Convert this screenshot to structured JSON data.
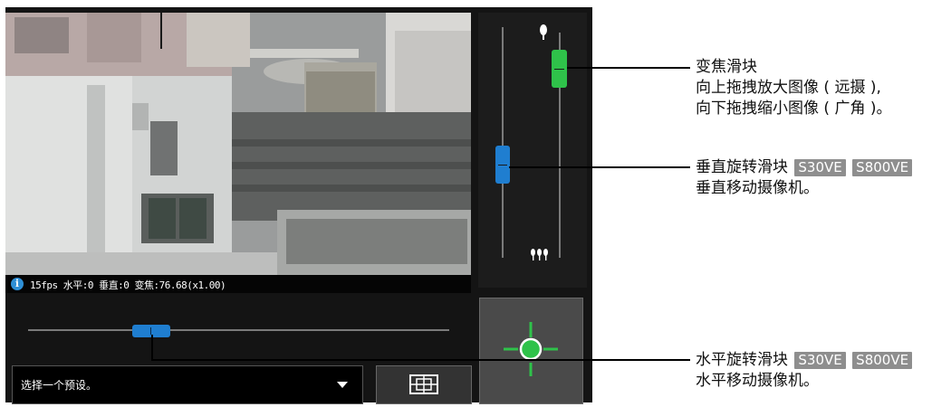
{
  "video": {
    "info_text": "15fps 水平:0 垂直:0 变焦:76.68(x1.00)"
  },
  "zoom_slider": {
    "tele_icon": "single-tree-icon",
    "wide_icon": "three-trees-icon",
    "handle_color": "#2fc24a"
  },
  "tilt_slider": {
    "handle_color": "#1f7ed0"
  },
  "pan_slider": {
    "handle_color": "#1f7ed0"
  },
  "preset": {
    "placeholder": "选择一个预设。"
  },
  "callouts": {
    "zoom": {
      "title": "变焦滑块",
      "line1": "向上拖拽放大图像 ( 远摄 ),",
      "line2": "向下拖拽缩小图像 ( 广角 )。"
    },
    "tilt": {
      "title": "垂直旋转滑块",
      "badge1": "S30VE",
      "badge2": "S800VE",
      "desc": "垂直移动摄像机。"
    },
    "pan": {
      "title": "水平旋转滑块",
      "badge1": "S30VE",
      "badge2": "S800VE",
      "desc": "水平移动摄像机。"
    }
  }
}
